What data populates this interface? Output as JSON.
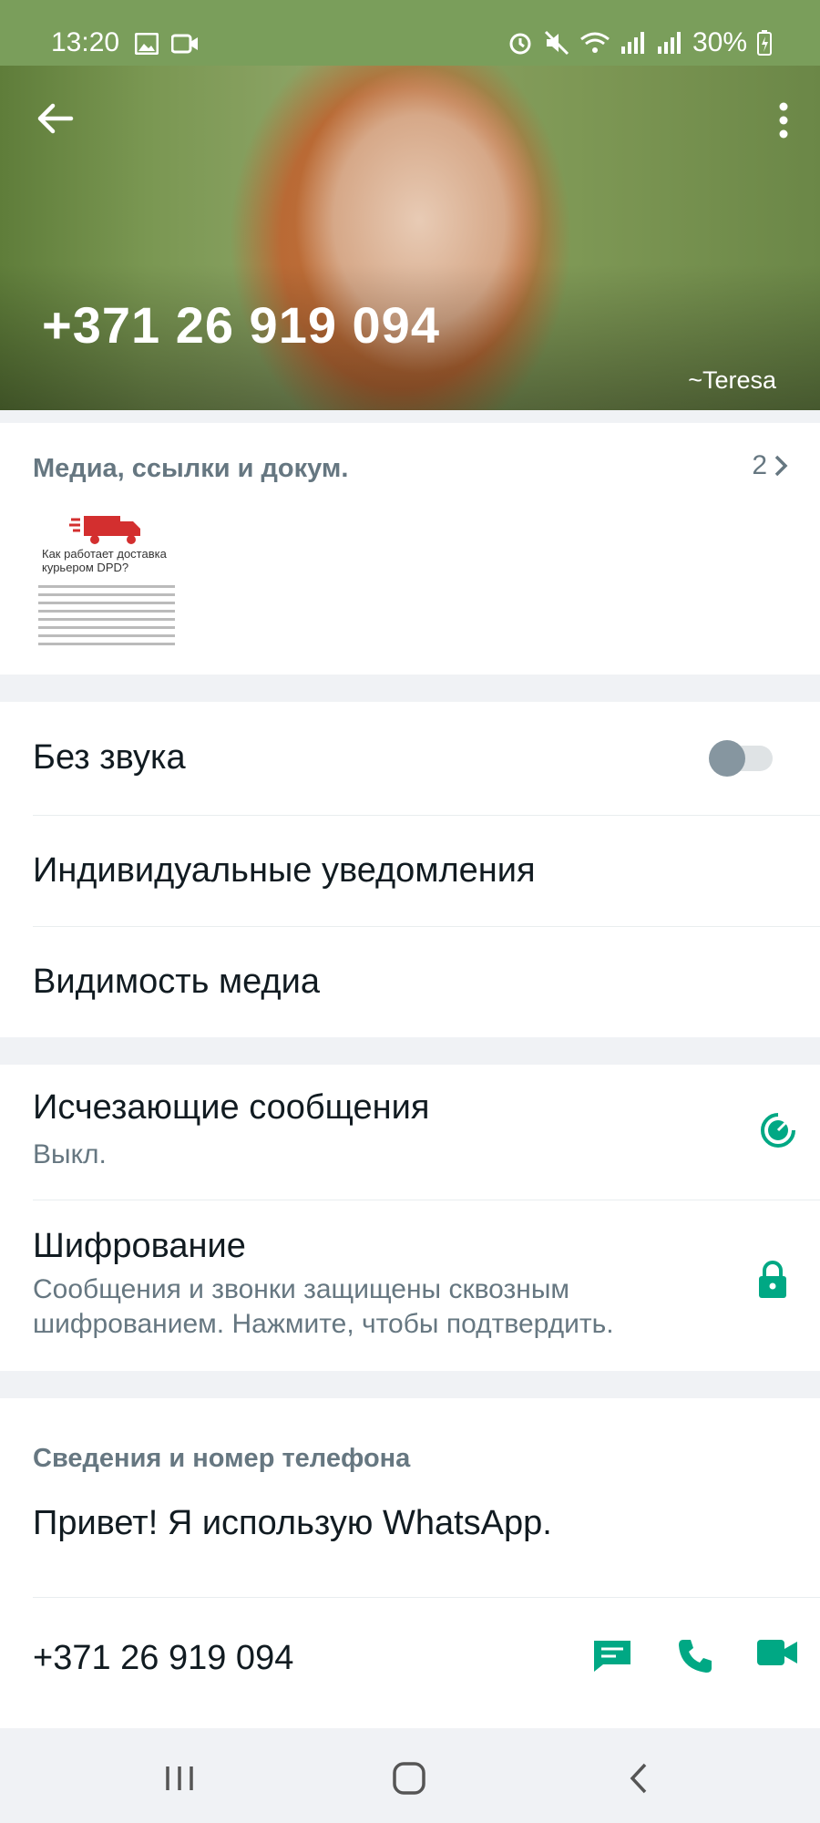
{
  "status_bar": {
    "time": "13:20",
    "battery": "30%"
  },
  "header": {
    "title": "+371 26 919 094",
    "push_name": "~Teresa"
  },
  "media": {
    "header": "Медиа, ссылки и докум.",
    "count": "2",
    "thumbnail_title": "Как работает доставка курьером DPD?"
  },
  "settings": {
    "mute_label": "Без звука",
    "mute_on": false,
    "custom_notifications_label": "Индивидуальные уведомления",
    "media_visibility_label": "Видимость медиа"
  },
  "privacy": {
    "disappearing_label": "Исчезающие сообщения",
    "disappearing_value": "Выкл.",
    "encryption_label": "Шифрование",
    "encryption_desc": "Сообщения и звонки защищены сквозным шифрованием. Нажмите, чтобы подтвердить."
  },
  "about": {
    "header": "Сведения и номер телефона",
    "status": "Привет! Я использую WhatsApp.",
    "phone": "+371 26 919 094"
  },
  "colors": {
    "accent": "#00a884",
    "status_bar": "#7a9e5b",
    "secondary_text": "#667781"
  },
  "icons": [
    "back-arrow-icon",
    "more-vert-icon",
    "chevron-right-icon",
    "timer-icon",
    "lock-icon",
    "message-icon",
    "phone-icon",
    "video-icon"
  ]
}
